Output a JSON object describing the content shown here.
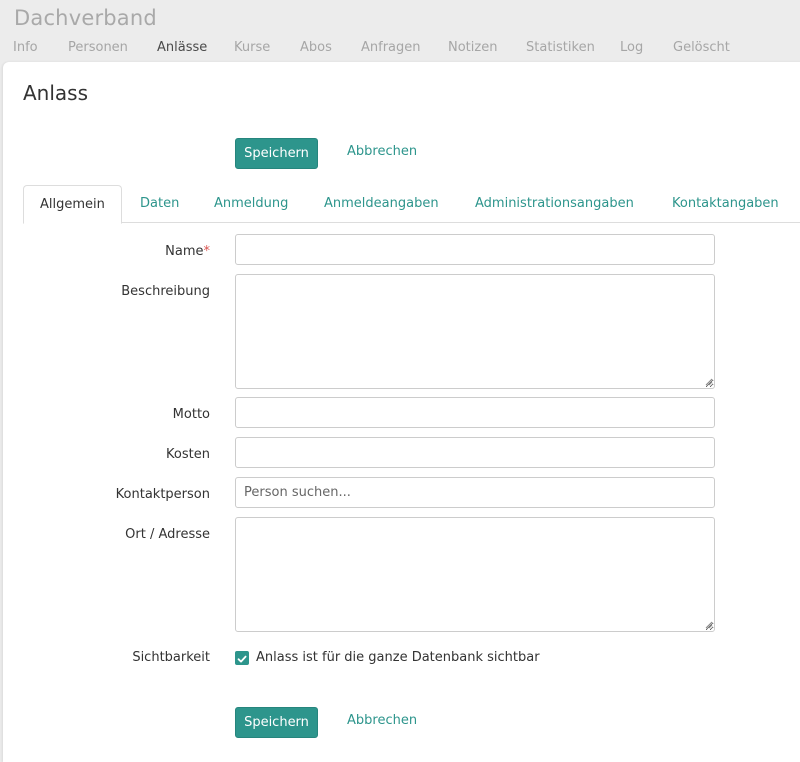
{
  "header": {
    "group_name": "Dachverband",
    "nav": [
      {
        "label": "Info",
        "active": false
      },
      {
        "label": "Personen",
        "active": false
      },
      {
        "label": "Anlässe",
        "active": true
      },
      {
        "label": "Kurse",
        "active": false
      },
      {
        "label": "Abos",
        "active": false
      },
      {
        "label": "Anfragen",
        "active": false
      },
      {
        "label": "Notizen",
        "active": false
      },
      {
        "label": "Statistiken",
        "active": false
      },
      {
        "label": "Log",
        "active": false
      },
      {
        "label": "Gelöscht",
        "active": false
      }
    ]
  },
  "page": {
    "title": "Anlass"
  },
  "actions": {
    "save_label": "Speichern",
    "cancel_label": "Abbrechen"
  },
  "tabs": [
    {
      "label": "Allgemein",
      "active": true
    },
    {
      "label": "Daten",
      "active": false
    },
    {
      "label": "Anmeldung",
      "active": false
    },
    {
      "label": "Anmeldeangaben",
      "active": false
    },
    {
      "label": "Administrationsangaben",
      "active": false
    },
    {
      "label": "Kontaktangaben",
      "active": false
    }
  ],
  "form": {
    "name": {
      "label": "Name",
      "required_marker": "*",
      "value": ""
    },
    "beschreibung": {
      "label": "Beschreibung",
      "value": ""
    },
    "motto": {
      "label": "Motto",
      "value": ""
    },
    "kosten": {
      "label": "Kosten",
      "value": ""
    },
    "kontaktperson": {
      "label": "Kontaktperson",
      "placeholder": "Person suchen...",
      "value": ""
    },
    "ort": {
      "label": "Ort / Adresse",
      "value": ""
    },
    "sichtbarkeit": {
      "label": "Sichtbarkeit",
      "checkbox_label": "Anlass ist für die ganze Datenbank sichtbar",
      "checked": true
    }
  },
  "colors": {
    "accent": "#2d958c",
    "required": "#d9534f",
    "background": "#ececec"
  }
}
